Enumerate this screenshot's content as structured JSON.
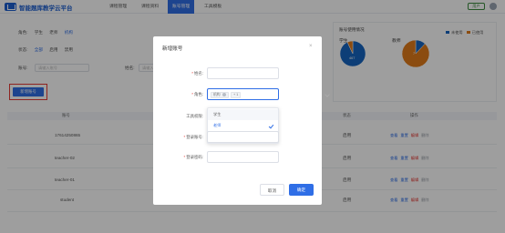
{
  "header": {
    "brand": "智能题库教学云平台",
    "nav": [
      "课程管理",
      "课程资料",
      "账号管理",
      "工具模板"
    ],
    "user": "用户"
  },
  "filters": {
    "role_label": "角色:",
    "roles": [
      "学生",
      "老师",
      "机构"
    ],
    "status_label": "状态:",
    "statuses": [
      "全部",
      "启用",
      "禁用"
    ],
    "account_label": "账号:",
    "account_placeholder": "请输入账号",
    "name_label": "姓名:",
    "name_placeholder": "请输入姓名"
  },
  "add_button": "新增账号",
  "chart_panel": {
    "title": "账号使用情况",
    "legend": [
      {
        "label": "未使用",
        "color": "#1565c0"
      },
      {
        "label": "已使用",
        "color": "#e07b1a"
      }
    ],
    "student_label": "学生",
    "teacher_label": "教师",
    "student_value": "467",
    "teacher_value": "7"
  },
  "chart_data": [
    {
      "type": "pie",
      "title": "学生",
      "categories": [
        "未使用",
        "已使用"
      ],
      "values": [
        93,
        7
      ],
      "colors": [
        "#1565c0",
        "#e07b1a"
      ],
      "data_labels": [
        "467"
      ]
    },
    {
      "type": "pie",
      "title": "教师",
      "categories": [
        "未使用",
        "已使用"
      ],
      "values": [
        12,
        88
      ],
      "colors": [
        "#1565c0",
        "#e07b1a"
      ],
      "data_labels": [
        "7"
      ]
    }
  ],
  "table": {
    "headers": [
      "账号",
      "状态",
      "操作"
    ],
    "rows": [
      {
        "account": "17614250865",
        "status": "启用",
        "ops": [
          "查看",
          "重置",
          "编辑",
          "删除"
        ]
      },
      {
        "account": "teacher-02",
        "status": "启用",
        "ops": [
          "查看",
          "重置",
          "编辑",
          "删除"
        ]
      },
      {
        "account": "teacher-01",
        "status": "启用",
        "ops": [
          "查看",
          "重置",
          "编辑",
          "删除"
        ]
      },
      {
        "account": "student",
        "status": "启用",
        "ops": [
          "查看",
          "重置",
          "编辑",
          "删除"
        ]
      }
    ]
  },
  "modal": {
    "title": "新增账号",
    "close": "×",
    "fields": {
      "name_label": "姓名:",
      "role_label": "角色:",
      "perm_label": "工具权限:",
      "login_account_label": "登录账号:",
      "login_password_label": "登录密码:"
    },
    "selected_tags": [
      "机构",
      "+ 1"
    ],
    "options": [
      "学生",
      "老师",
      "机构"
    ],
    "cancel": "取消",
    "confirm": "确定"
  }
}
